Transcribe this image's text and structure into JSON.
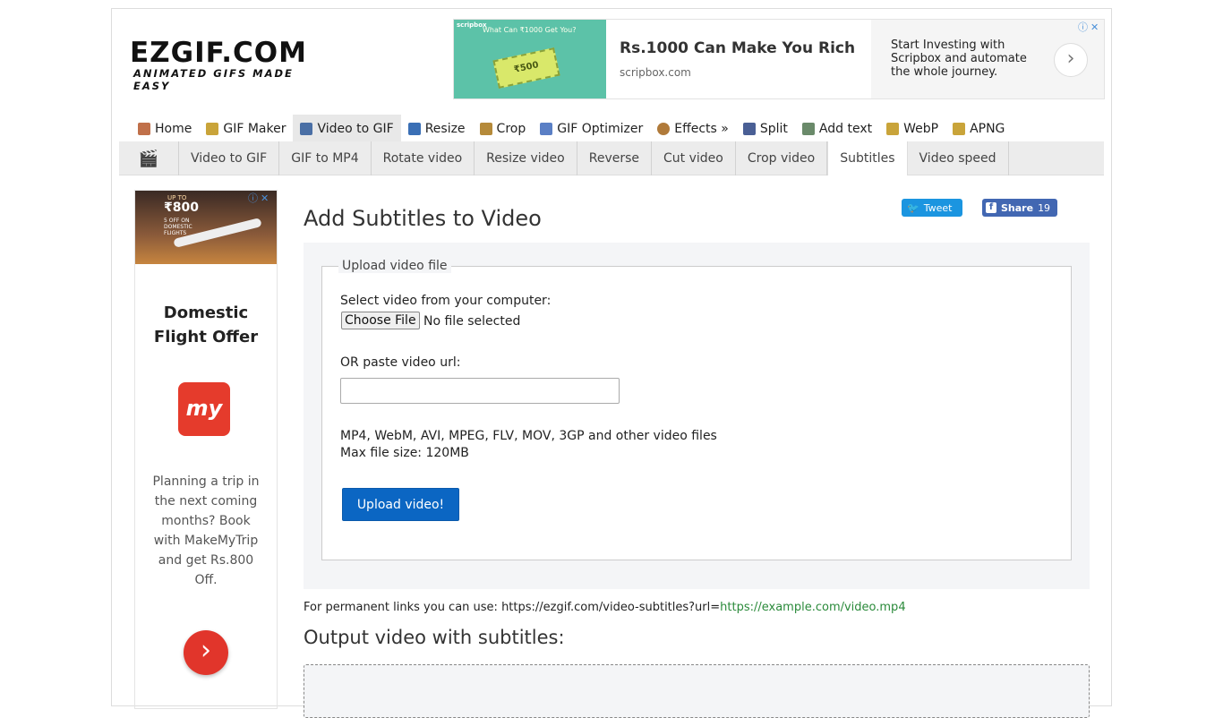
{
  "logo": {
    "main": "EZGIF.COM",
    "sub": "ANIMATED GIFS MADE EASY"
  },
  "top_ad": {
    "brand": "scripbox",
    "image_tagline": "What Can ₹1000 Get You?",
    "ticket": "₹500",
    "title": "Rs.1000 Can Make You Rich",
    "domain": "scripbox.com",
    "description": "Start Investing with Scripbox and automate the whole journey."
  },
  "main_nav": [
    {
      "label": "Home",
      "icon": "home-icon",
      "color": "#c0704a"
    },
    {
      "label": "GIF Maker",
      "icon": "gif-maker-icon",
      "color": "#c9a43a"
    },
    {
      "label": "Video to GIF",
      "icon": "film-icon",
      "color": "#4a6fa5"
    },
    {
      "label": "Resize",
      "icon": "resize-icon",
      "color": "#3a6fb5"
    },
    {
      "label": "Crop",
      "icon": "crop-icon",
      "color": "#b58a3a"
    },
    {
      "label": "GIF Optimizer",
      "icon": "optimizer-icon",
      "color": "#5a7fc5"
    },
    {
      "label": "Effects »",
      "icon": "palette-icon",
      "color": "#b07a3a"
    },
    {
      "label": "Split",
      "icon": "split-icon",
      "color": "#4a5f95"
    },
    {
      "label": "Add text",
      "icon": "text-icon",
      "color": "#6a8a6a"
    },
    {
      "label": "WebP",
      "icon": "webp-icon",
      "color": "#c9a43a"
    },
    {
      "label": "APNG",
      "icon": "apng-icon",
      "color": "#c9a43a"
    }
  ],
  "sub_nav": [
    "Video to GIF",
    "GIF to MP4",
    "Rotate video",
    "Resize video",
    "Reverse",
    "Cut video",
    "Crop video",
    "Subtitles",
    "Video speed"
  ],
  "side_ad": {
    "banner_upto": "UP TO",
    "banner_amount": "₹800",
    "banner_text": "5 OFF ON DOMESTIC FLIGHTS",
    "title": "Domestic Flight Offer",
    "logo_text": "my",
    "description": "Planning a trip in the next coming months? Book with MakeMyTrip and get Rs.800 Off."
  },
  "page_title": "Add Subtitles to Video",
  "social": {
    "tweet": "Tweet",
    "share": "Share",
    "share_count": "19"
  },
  "upload": {
    "legend": "Upload video file",
    "select_label": "Select video from your computer:",
    "choose_file": "Choose File",
    "no_file": "No file selected",
    "url_label": "OR paste video url:",
    "url_value": "",
    "formats": "MP4, WebM, AVI, MPEG, FLV, MOV, 3GP and other video files",
    "max_size": "Max file size: 120MB",
    "button": "Upload video!"
  },
  "permanent_links": {
    "prefix": "For permanent links you can use: https://ezgif.com/video-subtitles?url=",
    "link": "https://example.com/video.mp4"
  },
  "output_title": "Output video with subtitles:"
}
